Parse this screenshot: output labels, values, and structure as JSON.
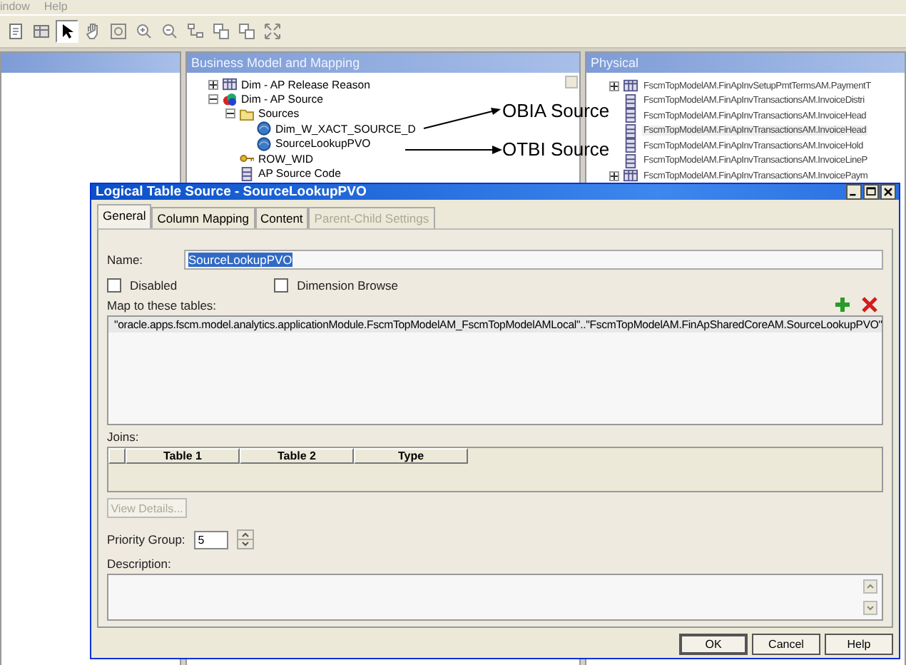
{
  "menu": [
    {
      "label": "indow"
    },
    {
      "label": "Help"
    }
  ],
  "toolbar": [
    {
      "kind": "page",
      "selected": false
    },
    {
      "kind": "grid",
      "selected": false
    },
    {
      "kind": "pointer",
      "selected": true
    },
    {
      "kind": "hand",
      "selected": false
    },
    {
      "kind": "fit",
      "selected": false
    },
    {
      "kind": "zoom-in",
      "selected": false
    },
    {
      "kind": "zoom-out",
      "selected": false
    },
    {
      "kind": "arrange",
      "selected": false
    },
    {
      "kind": "copy",
      "selected": false
    },
    {
      "kind": "copy",
      "selected": false
    },
    {
      "kind": "expand",
      "selected": false
    }
  ],
  "business_model": {
    "title": "Business Model and Mapping",
    "tree": [
      {
        "label": "Dim - AP Release Reason",
        "kind": "table",
        "expanded": false
      },
      {
        "label": "Dim - AP Source",
        "kind": "cube",
        "expanded": true,
        "children": [
          {
            "label": "Sources",
            "kind": "folder",
            "expanded": true,
            "children": [
              {
                "label": "Dim_W_XACT_SOURCE_D",
                "kind": "source"
              },
              {
                "label": "SourceLookupPVO",
                "kind": "source"
              }
            ]
          },
          {
            "label": "ROW_WID",
            "kind": "key"
          },
          {
            "label": "AP Source Code",
            "kind": "column"
          }
        ]
      }
    ]
  },
  "annotations": [
    {
      "label": "OBIA Source"
    },
    {
      "label": "OTBI Source"
    }
  ],
  "physical": {
    "title": "Physical",
    "items": [
      {
        "label": "FscmTopModelAM.FinApInvSetupPmtTermsAM.PaymentT",
        "expanded": false,
        "selected": false
      },
      {
        "label": "FscmTopModelAM.FinApInvTransactionsAM.InvoiceDistri",
        "selected": false
      },
      {
        "label": "FscmTopModelAM.FinApInvTransactionsAM.InvoiceHead",
        "selected": false
      },
      {
        "label": "FscmTopModelAM.FinApInvTransactionsAM.InvoiceHead",
        "selected": true
      },
      {
        "label": "FscmTopModelAM.FinApInvTransactionsAM.InvoiceHold",
        "selected": false
      },
      {
        "label": "FscmTopModelAM.FinApInvTransactionsAM.InvoiceLineP",
        "selected": false
      },
      {
        "label": "FscmTopModelAM.FinApInvTransactionsAM.InvoicePaym",
        "expanded": false,
        "selected": false
      }
    ]
  },
  "dialog": {
    "title": "Logical Table Source - SourceLookupPVO",
    "tabs": [
      {
        "label": "General",
        "selected": true,
        "disabled": false
      },
      {
        "label": "Column Mapping",
        "selected": false,
        "disabled": false
      },
      {
        "label": "Content",
        "selected": false,
        "disabled": false
      },
      {
        "label": "Parent-Child Settings",
        "selected": false,
        "disabled": true
      }
    ],
    "name": {
      "label": "Name:",
      "value": "SourceLookupPVO",
      "value_selected": true
    },
    "checkboxes": [
      {
        "label": "Disabled",
        "checked": false
      },
      {
        "label": "Dimension Browse",
        "checked": false
      }
    ],
    "map": {
      "label": "Map to these tables:",
      "rows": [
        "\"oracle.apps.fscm.model.analytics.applicationModule.FscmTopModelAM_FscmTopModelAMLocal\"..\"FscmTopModelAM.FinApSharedCoreAM.SourceLookupPVO\""
      ]
    },
    "joins": {
      "label": "Joins:",
      "columns": [
        "Table 1",
        "Table 2",
        "Type"
      ]
    },
    "view_details": {
      "label": "View Details...",
      "disabled": true
    },
    "priority": {
      "label": "Priority Group:",
      "value": "5"
    },
    "description": {
      "label": "Description:"
    },
    "buttons": [
      "OK",
      "Cancel",
      "Help"
    ]
  }
}
